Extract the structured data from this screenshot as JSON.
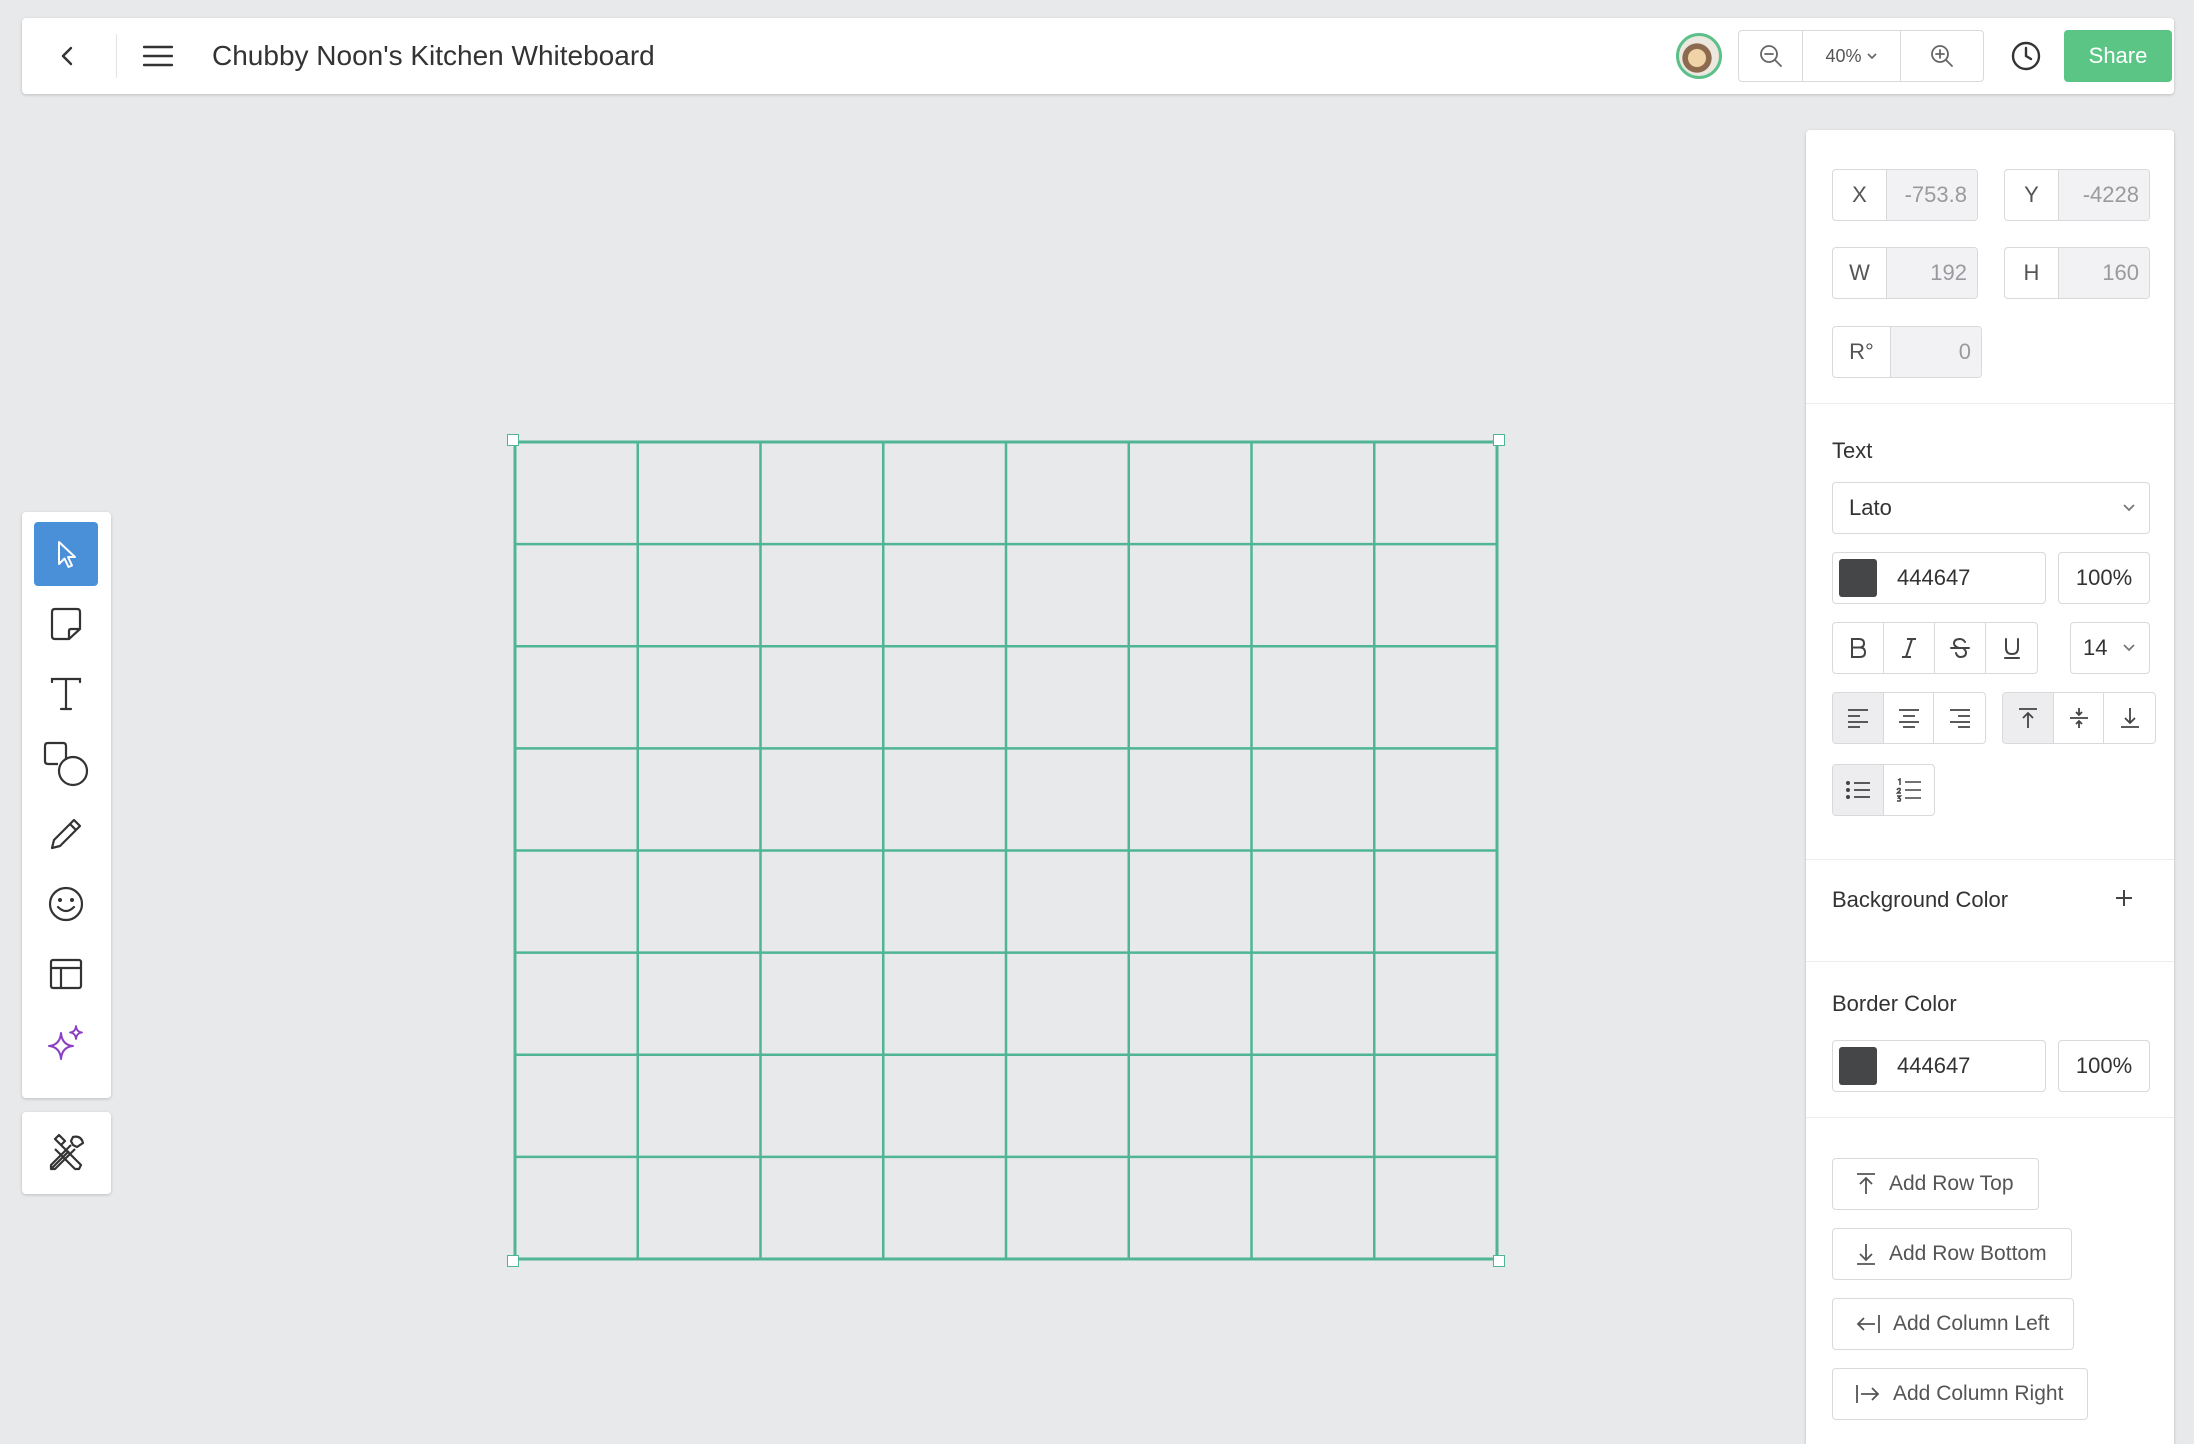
{
  "header": {
    "title": "Chubby Noon's Kitchen Whiteboard",
    "zoom": "40%",
    "share_label": "Share"
  },
  "toolbar": {
    "tools": [
      "select-tool",
      "sticky-note-tool",
      "text-tool",
      "shapes-tool",
      "pen-tool",
      "emoji-tool",
      "template-tool",
      "ai-tool"
    ],
    "active": "select-tool",
    "extra": "tools-tool"
  },
  "canvas": {
    "table": {
      "rows": 8,
      "columns": 8,
      "line_color": "#4fb594"
    }
  },
  "panel": {
    "position": {
      "x_label": "X",
      "x_value": "-753.8",
      "y_label": "Y",
      "y_value": "-4228"
    },
    "size": {
      "w_label": "W",
      "w_value": "192",
      "h_label": "H",
      "h_value": "160"
    },
    "rotation": {
      "label": "R°",
      "value": "0"
    },
    "text": {
      "heading": "Text",
      "font": "Lato",
      "color_hex": "444647",
      "color_swatch": "#444647",
      "opacity": "100%",
      "font_size": "14",
      "style_buttons": [
        "bold",
        "italic",
        "strikethrough",
        "underline"
      ],
      "align_buttons": [
        "align-left",
        "align-center",
        "align-right"
      ],
      "valign_buttons": [
        "align-top",
        "align-middle",
        "align-bottom"
      ],
      "list_buttons": [
        "bullet-list",
        "numbered-list"
      ]
    },
    "background_color": {
      "heading": "Background Color"
    },
    "border_color": {
      "heading": "Border Color",
      "color_hex": "444647",
      "color_swatch": "#444647",
      "opacity": "100%"
    },
    "actions": {
      "add_row_top": "Add Row Top",
      "add_row_bottom": "Add Row Bottom",
      "add_column_left": "Add Column Left",
      "add_column_right": "Add Column Right"
    }
  },
  "colors": {
    "accent_green": "#5ac585",
    "active_tool": "#4a90d9",
    "table_line": "#4fb594"
  }
}
